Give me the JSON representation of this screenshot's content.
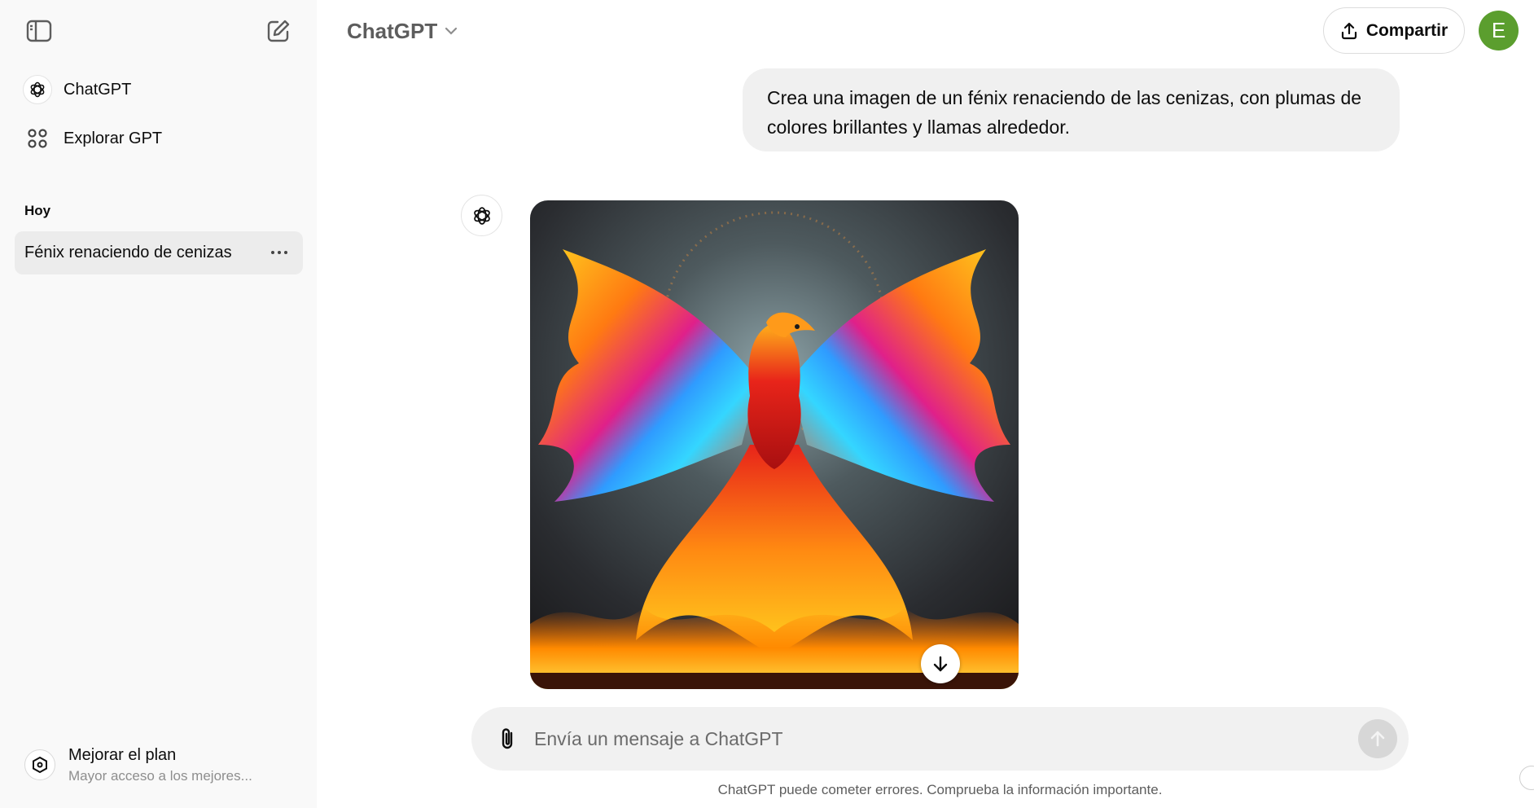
{
  "sidebar": {
    "toggle_icon": "sidebar-toggle-icon",
    "new_chat_icon": "new-chat-icon",
    "nav": [
      {
        "label": "ChatGPT",
        "icon": "openai-logo-icon"
      },
      {
        "label": "Explorar GPT",
        "icon": "grid-icon"
      }
    ],
    "section_label": "Hoy",
    "chats": [
      {
        "title": "Fénix renaciendo de cenizas"
      }
    ],
    "upgrade": {
      "title": "Mejorar el plan",
      "subtitle": "Mayor acceso a los mejores..."
    }
  },
  "header": {
    "model_name": "ChatGPT",
    "share_label": "Compartir",
    "avatar_initial": "E"
  },
  "conversation": {
    "user_message": "Crea una imagen de un fénix renaciendo de las cenizas, con plumas de colores brillantes y llamas alrededor.",
    "assistant_image_subject": "phoenix rising from flames"
  },
  "composer": {
    "placeholder": "Envía un mensaje a ChatGPT",
    "disclaimer": "ChatGPT puede cometer errores. Comprueba la información importante."
  },
  "colors": {
    "sidebar_bg": "#f9f9f9",
    "active_chat_bg": "#ececec",
    "avatar_bg": "#5b9e2e",
    "composer_bg": "#f1f1f1"
  }
}
